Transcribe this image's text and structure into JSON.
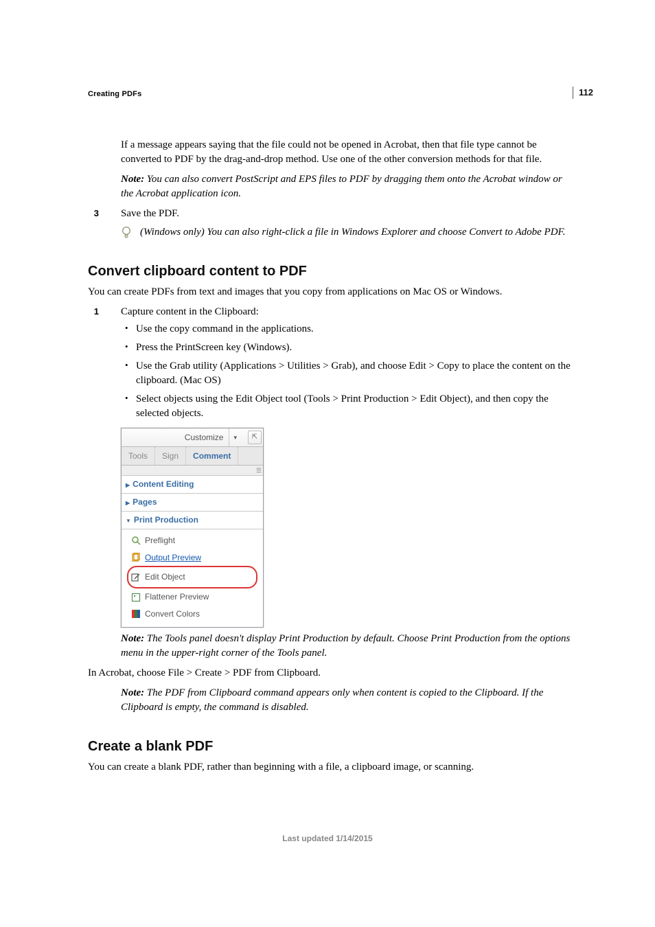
{
  "page_number": "112",
  "running_head": "Creating PDFs",
  "intro_continuation": {
    "p1": "If a message appears saying that the file could not be opened in Acrobat, then that file type cannot be converted to PDF by the drag-and-drop method. Use one of the other conversion methods for that file.",
    "note_label": "Note:",
    "note_body": " You can also convert PostScript and EPS files to PDF by dragging them onto the Acrobat window or the Acrobat application icon."
  },
  "step3_text": "Save the PDF.",
  "tip_text": "(Windows only) You can also right-click a file in Windows Explorer and choose Convert to Adobe PDF.",
  "section_clipboard": {
    "heading": "Convert clipboard content to PDF",
    "p1": "You can create PDFs from text and images that you copy from applications on Mac OS or Windows.",
    "step1_text": "Capture content in the Clipboard:",
    "bullets": [
      "Use the copy command in the applications.",
      "Press the PrintScreen key (Windows).",
      "Use the Grab utility (Applications > Utilities > Grab), and choose Edit > Copy to place the content on the clipboard. (Mac OS)",
      "Select objects using the Edit Object tool (Tools > Print Production > Edit Object), and then copy the selected objects."
    ],
    "panel_note_label": "Note:",
    "panel_note_body": " The Tools panel doesn't display Print Production by default. Choose Print Production from the options menu in the upper-right corner of the Tools panel.",
    "p_after": "In Acrobat, choose File > Create > PDF from Clipboard.",
    "clip_note_label": "Note:",
    "clip_note_body": " The PDF from Clipboard command appears only when content is copied to the Clipboard. If the Clipboard is empty, the command is disabled."
  },
  "section_blank": {
    "heading": "Create a blank PDF",
    "p1": "You can create a blank PDF, rather than beginning with a file, a clipboard image, or scanning."
  },
  "panel": {
    "customize_label": "Customize",
    "tabs": {
      "tools": "Tools",
      "sign": "Sign",
      "comment": "Comment"
    },
    "sections": {
      "content_editing": "Content Editing",
      "pages": "Pages",
      "print_production": "Print Production"
    },
    "items": {
      "preflight": "Preflight",
      "output_preview": "Output Preview",
      "edit_object": "Edit Object",
      "flattener_preview": "Flattener Preview",
      "convert_colors": "Convert Colors"
    }
  },
  "footer": "Last updated 1/14/2015"
}
